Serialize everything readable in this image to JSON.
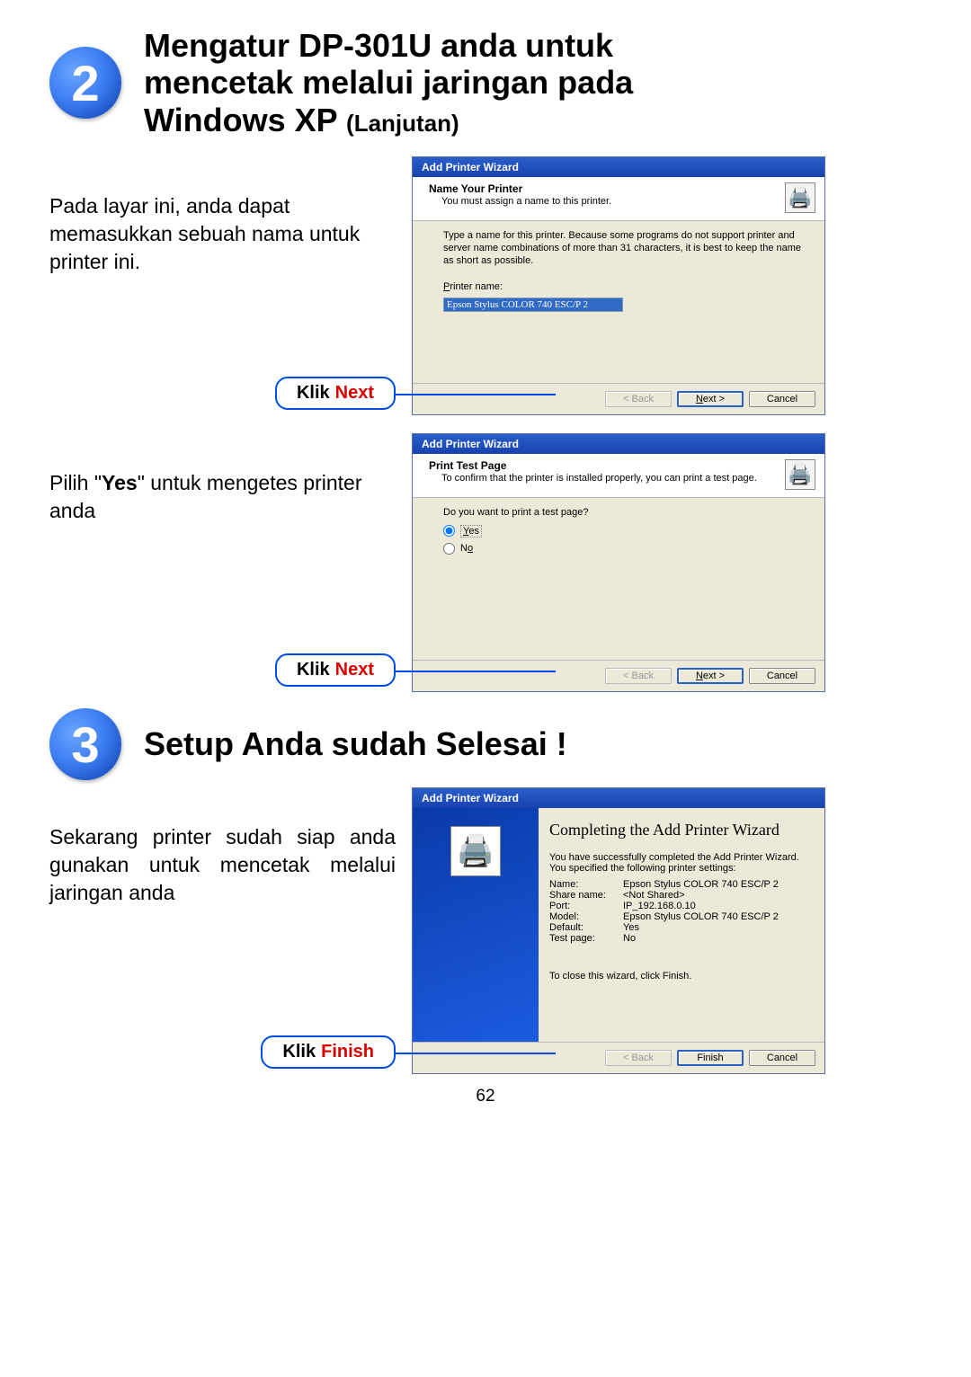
{
  "step2": {
    "badge": "2",
    "heading_l1": "Mengatur DP-301U anda untuk",
    "heading_l2": "mencetak melalui jaringan pada",
    "heading_l3a": "Windows XP ",
    "heading_l3b": "(Lanjutan)"
  },
  "block1": {
    "text": "Pada layar ini, anda dapat memasukkan sebuah nama untuk printer ini.",
    "klik": "Klik",
    "klik_target": "Next"
  },
  "wiz1": {
    "title": "Add Printer Wizard",
    "h1": "Name Your Printer",
    "h2": "You must assign a name to this printer.",
    "desc": "Type a name for this printer. Because some programs do not support printer and server name combinations of more than 31 characters, it is best to keep the name as short as possible.",
    "field_label": "Printer name:",
    "field_value": "Epson Stylus COLOR 740 ESC/P 2",
    "back": "< Back",
    "next": "Next >",
    "cancel": "Cancel"
  },
  "block2": {
    "pre": "Pilih \"",
    "bold": "Yes",
    "post": "\" untuk mengetes printer anda",
    "klik": "Klik",
    "klik_target": "Next"
  },
  "wiz2": {
    "title": "Add Printer Wizard",
    "h1": "Print Test Page",
    "h2": "To confirm that the printer is installed properly, you can print a test page.",
    "q": "Do you want to print a test page?",
    "yes": "Yes",
    "no": "No",
    "back": "< Back",
    "next": "Next >",
    "cancel": "Cancel"
  },
  "step3": {
    "badge": "3",
    "heading": "Setup Anda sudah Selesai !"
  },
  "block3": {
    "text": "Sekarang printer sudah siap anda gunakan untuk mencetak melalui jaringan anda",
    "klik": "Klik",
    "klik_target": "Finish"
  },
  "wiz3": {
    "title": "Add Printer Wizard",
    "big": "Completing the Add Printer Wizard",
    "desc": "You have successfully completed the Add Printer Wizard. You specified the following printer settings:",
    "rows": [
      {
        "k": "Name:",
        "v": "Epson Stylus COLOR 740 ESC/P 2"
      },
      {
        "k": "Share name:",
        "v": "<Not Shared>"
      },
      {
        "k": "Port:",
        "v": "IP_192.168.0.10"
      },
      {
        "k": "Model:",
        "v": "Epson Stylus COLOR 740 ESC/P 2"
      },
      {
        "k": "Default:",
        "v": "Yes"
      },
      {
        "k": "Test page:",
        "v": "No"
      }
    ],
    "close": "To close this wizard, click Finish.",
    "back": "< Back",
    "finish": "Finish",
    "cancel": "Cancel"
  },
  "page_number": "62"
}
